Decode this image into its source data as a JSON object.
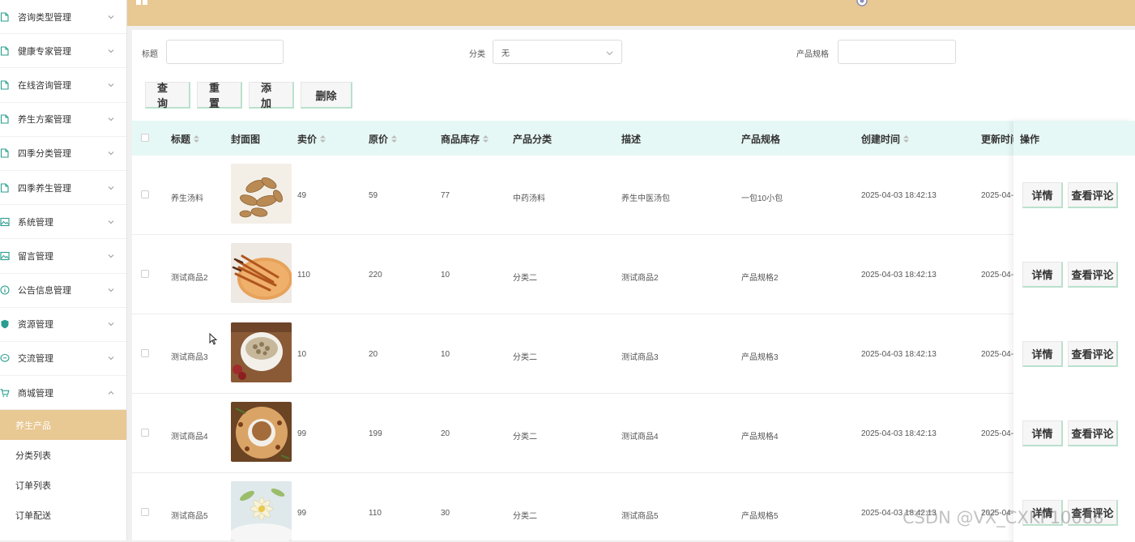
{
  "sidebar": {
    "items": [
      {
        "label": "咨询类型管理",
        "icon": "doc-icon"
      },
      {
        "label": "健康专家管理",
        "icon": "doc-icon"
      },
      {
        "label": "在线咨询管理",
        "icon": "doc-icon"
      },
      {
        "label": "养生方案管理",
        "icon": "doc-icon"
      },
      {
        "label": "四季分类管理",
        "icon": "doc-icon"
      },
      {
        "label": "四季养生管理",
        "icon": "doc-icon"
      },
      {
        "label": "系统管理",
        "icon": "image-icon"
      },
      {
        "label": "留言管理",
        "icon": "image-icon"
      },
      {
        "label": "公告信息管理",
        "icon": "info-icon"
      },
      {
        "label": "资源管理",
        "icon": "shield-icon"
      },
      {
        "label": "交流管理",
        "icon": "chat-icon"
      },
      {
        "label": "商城管理",
        "icon": "cart-icon"
      }
    ],
    "sub_items": [
      {
        "label": "养生产品",
        "active": true
      },
      {
        "label": "分类列表",
        "active": false
      },
      {
        "label": "订单列表",
        "active": false
      },
      {
        "label": "订单配送",
        "active": false
      }
    ]
  },
  "search": {
    "title_label": "标题",
    "title_value": "",
    "category_label": "分类",
    "category_value": "无",
    "spec_label": "产品规格",
    "spec_value": ""
  },
  "actions": {
    "query": "查询",
    "reset": "重置",
    "add": "添加",
    "delete": "删除"
  },
  "table": {
    "headers": {
      "title": "标题",
      "cover": "封面图",
      "price": "卖价",
      "original_price": "原价",
      "stock": "商品库存",
      "category": "产品分类",
      "description": "描述",
      "spec": "产品规格",
      "created": "创建时间",
      "updated": "更新时间",
      "ops": "操作"
    },
    "rows": [
      {
        "title": "养生汤料",
        "price": "49",
        "original_price": "59",
        "stock": "77",
        "category": "中药汤料",
        "description": "养生中医汤包",
        "spec": "一包10小包",
        "created": "2025-04-03 18:42:13",
        "updated": "2025-04-"
      },
      {
        "title": "测试商品2",
        "price": "110",
        "original_price": "220",
        "stock": "10",
        "category": "分类二",
        "description": "测试商品2",
        "spec": "产品规格2",
        "created": "2025-04-03 18:42:13",
        "updated": "2025-04-"
      },
      {
        "title": "测试商品3",
        "price": "10",
        "original_price": "20",
        "stock": "10",
        "category": "分类二",
        "description": "测试商品3",
        "spec": "产品规格3",
        "created": "2025-04-03 18:42:13",
        "updated": "2025-04-"
      },
      {
        "title": "测试商品4",
        "price": "99",
        "original_price": "199",
        "stock": "20",
        "category": "分类二",
        "description": "测试商品4",
        "spec": "产品规格4",
        "created": "2025-04-03 18:42:13",
        "updated": "2025-04-"
      },
      {
        "title": "测试商品5",
        "price": "99",
        "original_price": "110",
        "stock": "30",
        "category": "分类二",
        "description": "测试商品5",
        "spec": "产品规格5",
        "created": "2025-04-03 18:42:13",
        "updated": "2025-04-"
      }
    ],
    "detail_label": "详情",
    "comments_label": "查看评论"
  },
  "watermark": "CSDN @VX_CXKF10088",
  "colors": {
    "accent": "#e8c893",
    "table_header": "#e6f8f5",
    "button_border": "#b9e1cc",
    "menu_icon": "#2a9d8f"
  }
}
